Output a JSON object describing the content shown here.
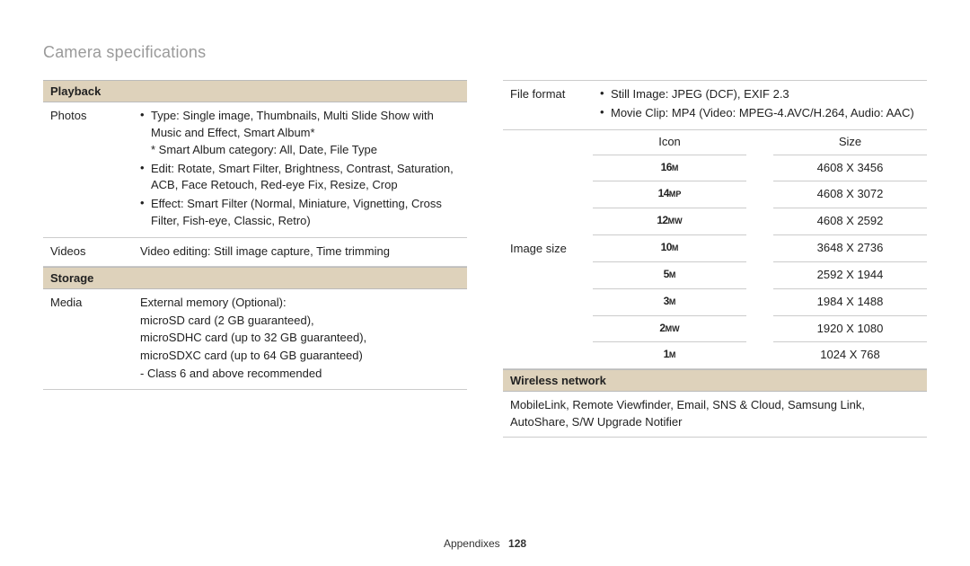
{
  "page_title": "Camera specifications",
  "footer": {
    "section": "Appendixes",
    "page": "128"
  },
  "left": {
    "playback_header": "Playback",
    "photos_label": "Photos",
    "photos_bullets": [
      "Type: Single image, Thumbnails, Multi Slide Show with Music and Effect, Smart Album*",
      "Edit: Rotate, Smart Filter, Brightness, Contrast, Saturation, ACB, Face Retouch, Red-eye Fix, Resize, Crop",
      "Effect: Smart Filter (Normal, Miniature, Vignetting, Cross Filter, Fish-eye, Classic, Retro)"
    ],
    "photos_sub": "* Smart Album category: All, Date, File Type",
    "videos_label": "Videos",
    "videos_value": "Video editing: Still image capture, Time trimming",
    "storage_header": "Storage",
    "media_label": "Media",
    "media_lines": [
      "External memory (Optional):",
      "microSD card (2 GB guaranteed),",
      "microSDHC card (up to 32 GB guaranteed),",
      "microSDXC card (up to 64 GB guaranteed)",
      "- Class 6 and above recommended"
    ]
  },
  "right": {
    "fileformat_label": "File format",
    "fileformat_bullets": [
      "Still Image: JPEG (DCF), EXIF 2.3",
      "Movie Clip: MP4 (Video: MPEG-4.AVC/H.264, Audio: AAC)"
    ],
    "imagesize_label": "Image size",
    "img_headers": {
      "icon": "Icon",
      "size": "Size"
    },
    "img_rows": [
      {
        "big": "16",
        "sub": "M",
        "size": "4608 X 3456"
      },
      {
        "big": "14",
        "sub": "MP",
        "size": "4608 X 3072"
      },
      {
        "big": "12",
        "sub": "MW",
        "size": "4608 X 2592"
      },
      {
        "big": "10",
        "sub": "M",
        "size": "3648 X 2736"
      },
      {
        "big": "5",
        "sub": "M",
        "size": "2592 X 1944"
      },
      {
        "big": "3",
        "sub": "M",
        "size": "1984 X 1488"
      },
      {
        "big": "2",
        "sub": "MW",
        "size": "1920 X 1080"
      },
      {
        "big": "1",
        "sub": "M",
        "size": "1024 X 768"
      }
    ],
    "wireless_header": "Wireless network",
    "wireless_value": "MobileLink, Remote Viewfinder, Email, SNS & Cloud, Samsung Link, AutoShare, S/W Upgrade Notifier"
  }
}
